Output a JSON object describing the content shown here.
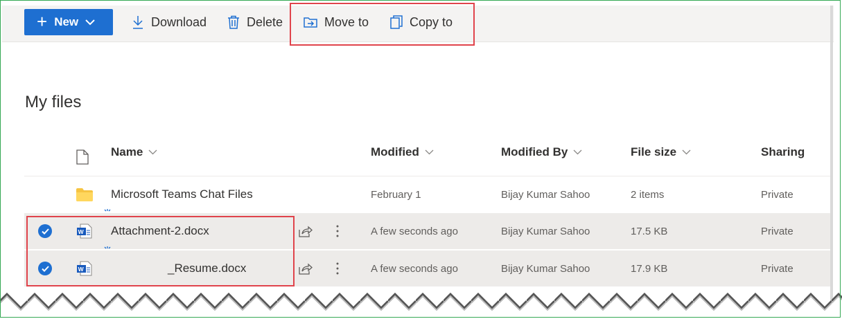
{
  "toolbar": {
    "new_label": "New",
    "download_label": "Download",
    "delete_label": "Delete",
    "move_to_label": "Move to",
    "copy_to_label": "Copy to"
  },
  "page": {
    "title": "My files"
  },
  "columns": {
    "name": "Name",
    "modified": "Modified",
    "modified_by": "Modified By",
    "file_size": "File size",
    "sharing": "Sharing"
  },
  "files": [
    {
      "name": "Microsoft Teams Chat Files",
      "type": "folder",
      "modified": "February 1",
      "modified_by": "Bijay Kumar Sahoo",
      "size": "2 items",
      "sharing": "Private",
      "selected": false
    },
    {
      "name": "Attachment-2.docx",
      "type": "word",
      "modified": "A few seconds ago",
      "modified_by": "Bijay Kumar Sahoo",
      "size": "17.5 KB",
      "sharing": "Private",
      "selected": true
    },
    {
      "name": "_Resume.docx",
      "type": "word",
      "modified": "A few seconds ago",
      "modified_by": "Bijay Kumar Sahoo",
      "size": "17.9 KB",
      "sharing": "Private",
      "selected": true
    }
  ],
  "colors": {
    "accent": "#1e6fd1",
    "highlight": "#e0434b",
    "selected_row": "#edebe9"
  },
  "icons": [
    "plus-icon",
    "chevron-down-icon",
    "download-icon",
    "trash-icon",
    "move-icon",
    "copy-icon",
    "file-icon",
    "folder-icon",
    "word-icon",
    "share-icon",
    "more-icon",
    "check-icon"
  ]
}
